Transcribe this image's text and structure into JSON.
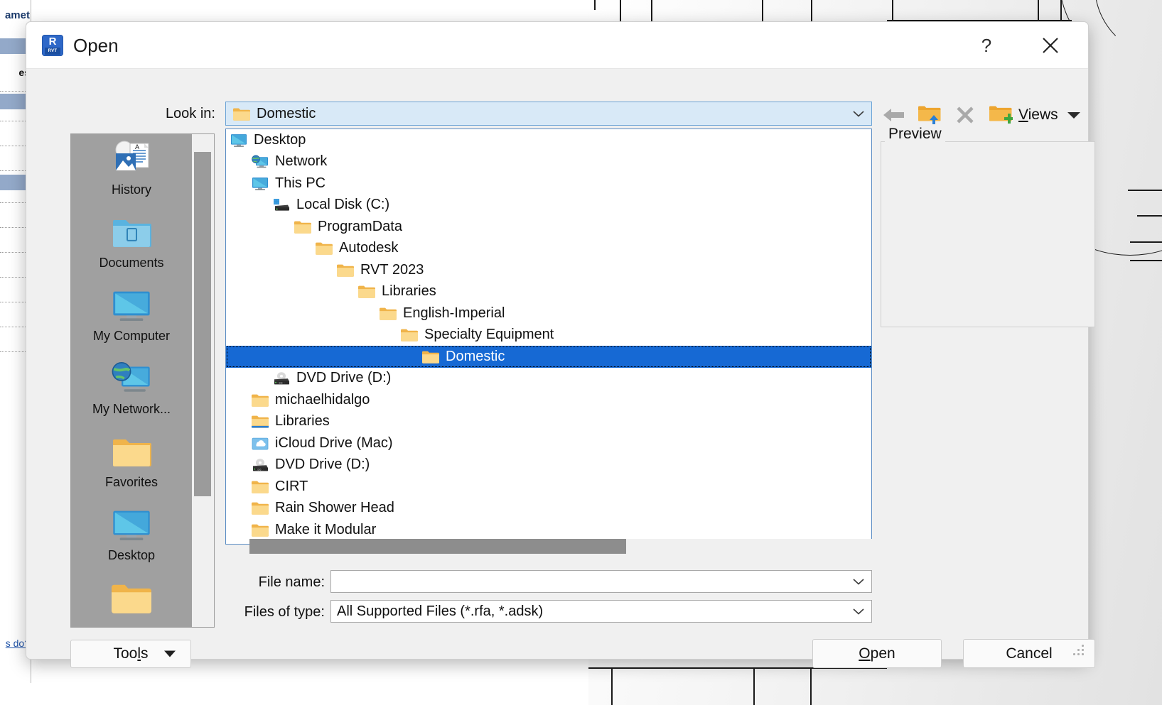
{
  "background": {
    "properties_panel": {
      "title_fragment": "amet",
      "bold_row_fragment": "es",
      "link_fragment": "s do?"
    }
  },
  "dialog": {
    "title": "Open",
    "app_icon": {
      "name": "revit-rvt-icon",
      "letter": "R",
      "sub": "RVT"
    },
    "help_button": "?",
    "close_button": "✕",
    "lookin": {
      "label": "Look in:",
      "value": "Domestic",
      "icon": "folder-icon"
    },
    "toolbar": {
      "back": "back-arrow-icon",
      "up_folder": "up-one-level-icon",
      "delete": "delete-icon",
      "new_folder": "create-new-folder-icon",
      "views_label": "Views",
      "views_accesskey": "V",
      "views_rest": "iews"
    },
    "places": [
      {
        "label": "History",
        "icon": "history-icon"
      },
      {
        "label": "Documents",
        "icon": "documents-folder-icon"
      },
      {
        "label": "My Computer",
        "icon": "my-computer-icon"
      },
      {
        "label": "My Network...",
        "icon": "my-network-icon"
      },
      {
        "label": "Favorites",
        "icon": "favorites-folder-icon"
      },
      {
        "label": "Desktop",
        "icon": "desktop-icon"
      },
      {
        "label": "",
        "icon": "folder-icon"
      }
    ],
    "tree": [
      {
        "label": "Desktop",
        "indent": 0,
        "icon": "desktop-monitor-icon",
        "selected": false
      },
      {
        "label": "Network",
        "indent": 1,
        "icon": "network-icon",
        "selected": false
      },
      {
        "label": "This PC",
        "indent": 1,
        "icon": "this-pc-icon",
        "selected": false
      },
      {
        "label": "Local Disk (C:)",
        "indent": 2,
        "icon": "local-disk-icon",
        "selected": false
      },
      {
        "label": "ProgramData",
        "indent": 3,
        "icon": "folder-icon",
        "selected": false
      },
      {
        "label": "Autodesk",
        "indent": 4,
        "icon": "folder-icon",
        "selected": false
      },
      {
        "label": "RVT 2023",
        "indent": 5,
        "icon": "folder-icon",
        "selected": false
      },
      {
        "label": "Libraries",
        "indent": 6,
        "icon": "folder-icon",
        "selected": false
      },
      {
        "label": "English-Imperial",
        "indent": 7,
        "icon": "folder-icon",
        "selected": false
      },
      {
        "label": "Specialty Equipment",
        "indent": 8,
        "icon": "folder-icon",
        "selected": false
      },
      {
        "label": "Domestic",
        "indent": 9,
        "icon": "folder-icon",
        "selected": true
      },
      {
        "label": "DVD Drive (D:)",
        "indent": 2,
        "icon": "dvd-drive-icon",
        "selected": false
      },
      {
        "label": "michaelhidalgo",
        "indent": 1,
        "icon": "folder-icon",
        "selected": false
      },
      {
        "label": "Libraries",
        "indent": 1,
        "icon": "libraries-folder-icon",
        "selected": false
      },
      {
        "label": "iCloud Drive (Mac)",
        "indent": 1,
        "icon": "icloud-drive-icon",
        "selected": false
      },
      {
        "label": "DVD Drive (D:)",
        "indent": 1,
        "icon": "dvd-drive-icon",
        "selected": false
      },
      {
        "label": "CIRT",
        "indent": 1,
        "icon": "folder-icon",
        "selected": false
      },
      {
        "label": "Rain Shower Head",
        "indent": 1,
        "icon": "folder-icon",
        "selected": false
      },
      {
        "label": "Make it Modular",
        "indent": 1,
        "icon": "folder-icon",
        "selected": false
      }
    ],
    "preview": {
      "legend": "Preview"
    },
    "filename": {
      "label": "File name:",
      "value": "",
      "placeholder": ""
    },
    "filetype": {
      "label": "Files of type:",
      "value": "All Supported Files  (*.rfa, *.adsk)"
    },
    "buttons": {
      "tools": "Tools",
      "tools_accesskey_prefix": "Too",
      "tools_accesskey": "l",
      "tools_accesskey_suffix": "s",
      "open_accesskey": "O",
      "open_rest": "pen",
      "open": "Open",
      "cancel": "Cancel"
    }
  },
  "colors": {
    "dialog_bg": "#f0f0f0",
    "titlebar_bg": "#ffffff",
    "selection_blue": "#1669d4",
    "combo_blue": "#d8e9f7",
    "combo_border": "#6ba3d6",
    "places_bg": "#a0a0a0",
    "folder_yellow": "#f7c95c",
    "accent_rvt": "#2e68c8"
  }
}
